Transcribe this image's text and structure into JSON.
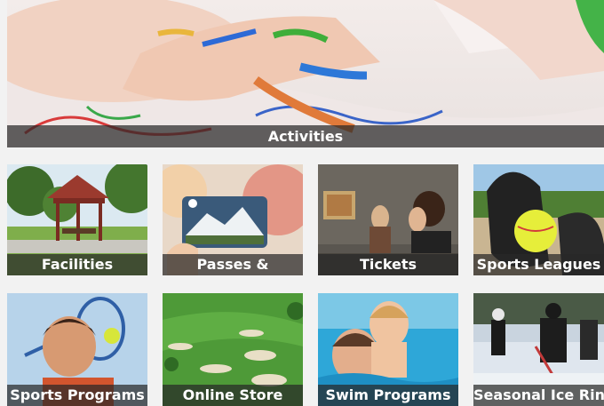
{
  "hero": {
    "label": "Activities"
  },
  "tiles": [
    {
      "label": "Facilities",
      "image": "park-gazebo"
    },
    {
      "label": "Passes &",
      "image": "pass-card-mountain"
    },
    {
      "label": "Tickets",
      "image": "museum-visitors"
    },
    {
      "label": "Sports Leagues",
      "image": "softball-glove"
    },
    {
      "label": "Sports Programs",
      "image": "boy-tennis"
    },
    {
      "label": "Online Store",
      "image": "golf-course-aerial"
    },
    {
      "label": "Swim Programs",
      "image": "pool-family"
    },
    {
      "label": "Seasonal Ice Rink",
      "image": "hockey-players"
    }
  ]
}
